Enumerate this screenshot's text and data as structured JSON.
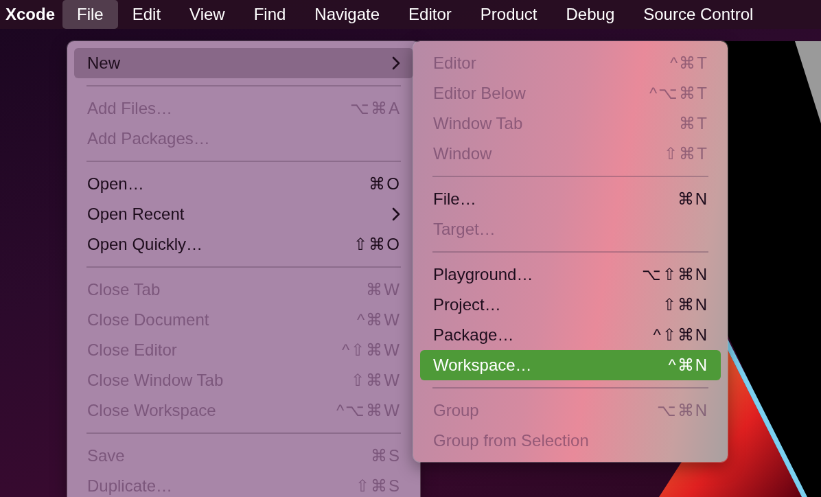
{
  "menu_bar": [
    {
      "label": "Xcode",
      "kind": "app",
      "selected": false
    },
    {
      "label": "File",
      "kind": "menu",
      "selected": true
    },
    {
      "label": "Edit",
      "kind": "menu",
      "selected": false
    },
    {
      "label": "View",
      "kind": "menu",
      "selected": false
    },
    {
      "label": "Find",
      "kind": "menu",
      "selected": false
    },
    {
      "label": "Navigate",
      "kind": "menu",
      "selected": false
    },
    {
      "label": "Editor",
      "kind": "menu",
      "selected": false
    },
    {
      "label": "Product",
      "kind": "menu",
      "selected": false
    },
    {
      "label": "Debug",
      "kind": "menu",
      "selected": false
    },
    {
      "label": "Source Control",
      "kind": "menu",
      "selected": false
    }
  ],
  "file_menu": [
    {
      "kind": "item",
      "label": "New",
      "submenu": true,
      "disabled": false,
      "selected": true
    },
    {
      "kind": "separator"
    },
    {
      "kind": "item",
      "label": "Add Files…",
      "shortcut": "⌥⌘A",
      "disabled": true,
      "selected": false
    },
    {
      "kind": "item",
      "label": "Add Packages…",
      "disabled": true,
      "selected": false
    },
    {
      "kind": "separator"
    },
    {
      "kind": "item",
      "label": "Open…",
      "shortcut": "⌘O",
      "disabled": false,
      "selected": false
    },
    {
      "kind": "item",
      "label": "Open Recent",
      "submenu": true,
      "disabled": false,
      "selected": false
    },
    {
      "kind": "item",
      "label": "Open Quickly…",
      "shortcut": "⇧⌘O",
      "disabled": false,
      "selected": false
    },
    {
      "kind": "separator"
    },
    {
      "kind": "item",
      "label": "Close Tab",
      "shortcut": "⌘W",
      "disabled": true,
      "selected": false
    },
    {
      "kind": "item",
      "label": "Close Document",
      "shortcut": "^⌘W",
      "disabled": true,
      "selected": false
    },
    {
      "kind": "item",
      "label": "Close Editor",
      "shortcut": "^⇧⌘W",
      "disabled": true,
      "selected": false
    },
    {
      "kind": "item",
      "label": "Close Window Tab",
      "shortcut": "⇧⌘W",
      "disabled": true,
      "selected": false
    },
    {
      "kind": "item",
      "label": "Close Workspace",
      "shortcut": "^⌥⌘W",
      "disabled": true,
      "selected": false
    },
    {
      "kind": "separator"
    },
    {
      "kind": "item",
      "label": "Save",
      "shortcut": "⌘S",
      "disabled": true,
      "selected": false
    },
    {
      "kind": "item",
      "label": "Duplicate…",
      "shortcut": "⇧⌘S",
      "disabled": true,
      "selected": false
    }
  ],
  "new_submenu": [
    {
      "kind": "item",
      "label": "Editor",
      "shortcut": "^⌘T",
      "disabled": true,
      "selected": false
    },
    {
      "kind": "item",
      "label": "Editor Below",
      "shortcut": "^⌥⌘T",
      "disabled": true,
      "selected": false
    },
    {
      "kind": "item",
      "label": "Window Tab",
      "shortcut": "⌘T",
      "disabled": true,
      "selected": false
    },
    {
      "kind": "item",
      "label": "Window",
      "shortcut": "⇧⌘T",
      "disabled": true,
      "selected": false
    },
    {
      "kind": "separator"
    },
    {
      "kind": "item",
      "label": "File…",
      "shortcut": "⌘N",
      "disabled": false,
      "selected": false
    },
    {
      "kind": "item",
      "label": "Target…",
      "disabled": true,
      "selected": false
    },
    {
      "kind": "separator"
    },
    {
      "kind": "item",
      "label": "Playground…",
      "shortcut": "⌥⇧⌘N",
      "disabled": false,
      "selected": false
    },
    {
      "kind": "item",
      "label": "Project…",
      "shortcut": "⇧⌘N",
      "disabled": false,
      "selected": false
    },
    {
      "kind": "item",
      "label": "Package…",
      "shortcut": "^⇧⌘N",
      "disabled": false,
      "selected": false
    },
    {
      "kind": "item",
      "label": "Workspace…",
      "shortcut": "^⌘N",
      "disabled": false,
      "selected": true
    },
    {
      "kind": "separator"
    },
    {
      "kind": "item",
      "label": "Group",
      "shortcut": "⌥⌘N",
      "disabled": true,
      "selected": false
    },
    {
      "kind": "item",
      "label": "Group from Selection",
      "disabled": true,
      "selected": false
    }
  ]
}
